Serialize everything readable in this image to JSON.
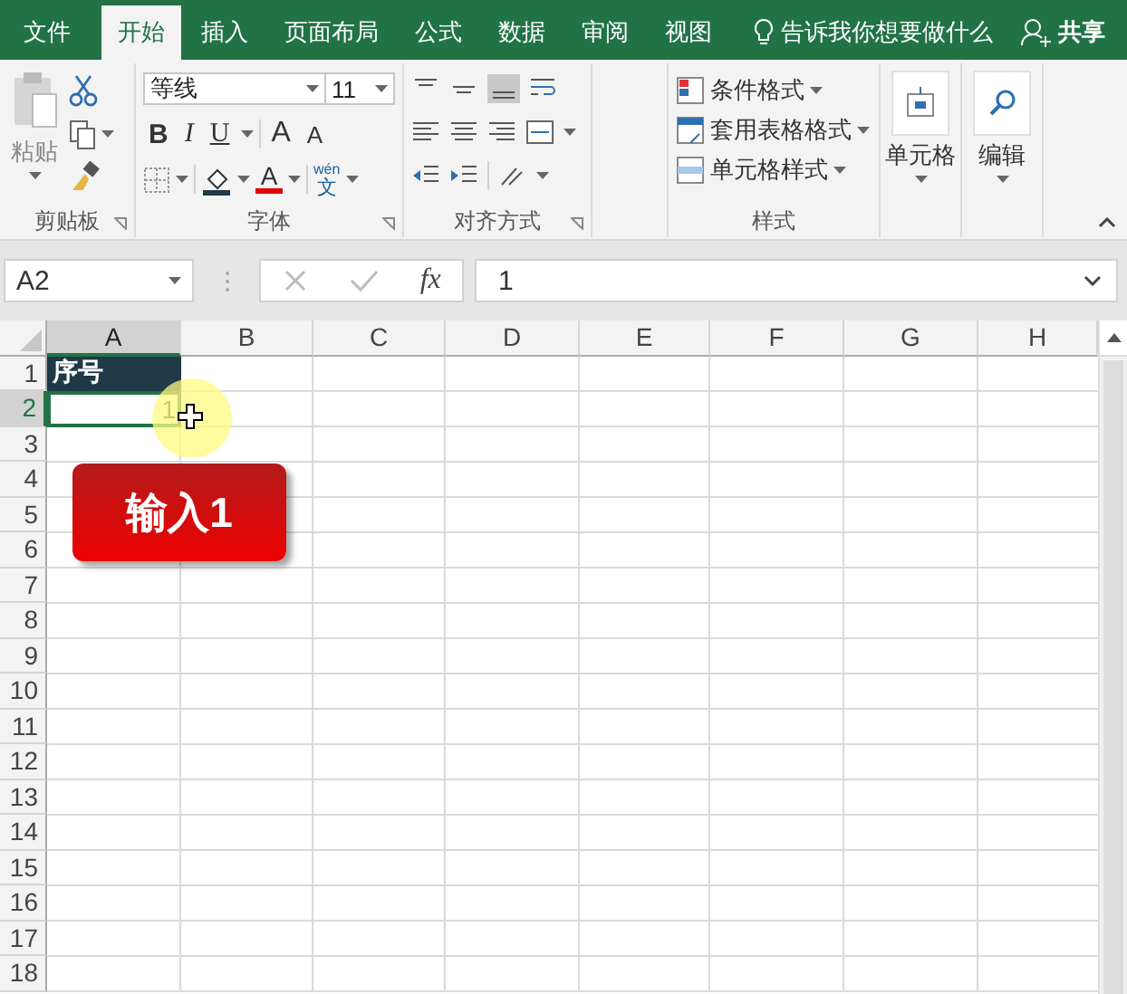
{
  "tabs": [
    {
      "label": "文件",
      "selected": false
    },
    {
      "label": "开始",
      "selected": true
    },
    {
      "label": "插入",
      "selected": false
    },
    {
      "label": "页面布局",
      "selected": false
    },
    {
      "label": "公式",
      "selected": false
    },
    {
      "label": "数据",
      "selected": false
    },
    {
      "label": "审阅",
      "selected": false
    },
    {
      "label": "视图",
      "selected": false
    }
  ],
  "tell_me": {
    "placeholder": "告诉我你想要做什么"
  },
  "share_button": "共享",
  "ribbon": {
    "clipboard": {
      "paste": "粘贴",
      "label": "剪贴板"
    },
    "font": {
      "font_name": "等线",
      "font_size": "11",
      "format_buttons": [
        "B",
        "I",
        "U"
      ],
      "size_buttons": [
        "A",
        "A"
      ],
      "font_color": "A",
      "phonetic": {
        "top": "wén",
        "bottom": "文"
      },
      "label": "字体"
    },
    "alignment": {
      "label": "对齐方式"
    },
    "styles": {
      "items": [
        "条件格式",
        "套用表格格式",
        "单元格样式"
      ],
      "label": "样式"
    },
    "cells": {
      "label": "单元格"
    },
    "editing": {
      "label": "编辑"
    }
  },
  "formula_bar": {
    "name_box": "A2",
    "fx": "fx",
    "value": "1"
  },
  "sheet": {
    "columns": [
      {
        "label": "A",
        "selected": true
      },
      {
        "label": "B",
        "selected": false
      },
      {
        "label": "C",
        "selected": false
      },
      {
        "label": "D",
        "selected": false
      },
      {
        "label": "E",
        "selected": false
      },
      {
        "label": "F",
        "selected": false
      },
      {
        "label": "G",
        "selected": false
      },
      {
        "label": "H",
        "selected": false
      }
    ],
    "rows": [
      {
        "label": "1",
        "selected": false,
        "cells": [
          {
            "text": "序号",
            "kind": "header"
          }
        ]
      },
      {
        "label": "2",
        "selected": true,
        "cells": [
          {
            "text": "1",
            "kind": "editing"
          }
        ]
      },
      {
        "label": "3",
        "selected": false
      },
      {
        "label": "4",
        "selected": false
      },
      {
        "label": "5",
        "selected": false
      },
      {
        "label": "6",
        "selected": false
      },
      {
        "label": "7",
        "selected": false
      },
      {
        "label": "8",
        "selected": false
      },
      {
        "label": "9",
        "selected": false
      },
      {
        "label": "10",
        "selected": false
      },
      {
        "label": "11",
        "selected": false
      },
      {
        "label": "12",
        "selected": false
      },
      {
        "label": "13",
        "selected": false
      },
      {
        "label": "14",
        "selected": false
      },
      {
        "label": "15",
        "selected": false
      },
      {
        "label": "16",
        "selected": false
      },
      {
        "label": "17",
        "selected": false
      },
      {
        "label": "18",
        "selected": false
      }
    ],
    "callout": "输入1"
  }
}
